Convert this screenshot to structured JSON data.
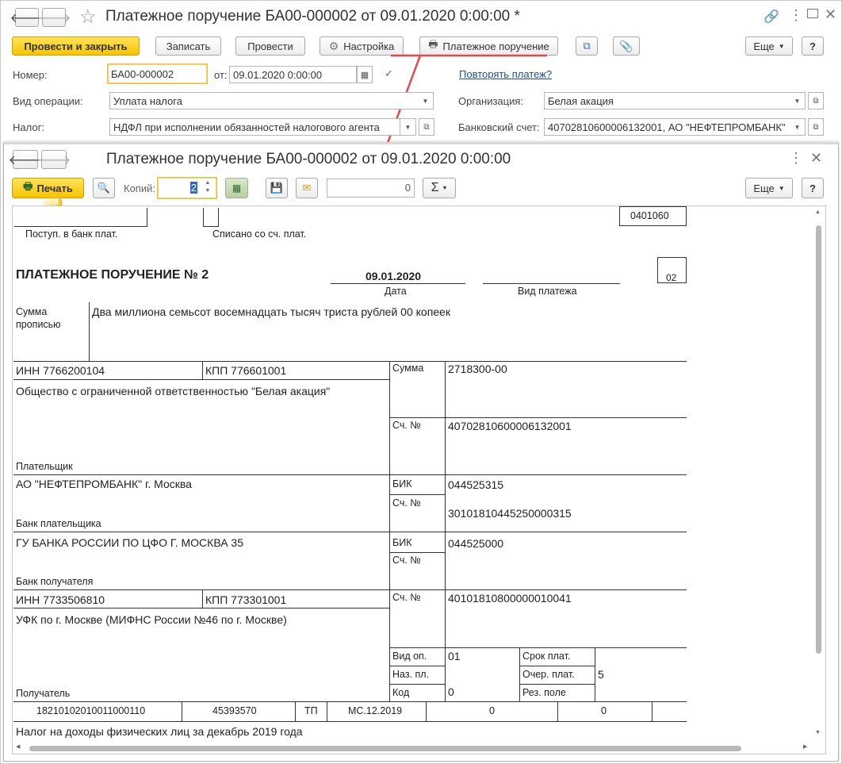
{
  "outer": {
    "title": "Платежное поручение БА00-000002 от 09.01.2020 0:00:00 *",
    "toolbar": {
      "post_close": "Провести и закрыть",
      "save": "Записать",
      "post": "Провести",
      "settings": "Настройка",
      "payment_order": "Платежное поручение",
      "more": "Еще",
      "help": "?"
    },
    "fields": {
      "number_label": "Номер:",
      "number_value": "БА00-000002",
      "date_label": "от:",
      "date_value": "09.01.2020  0:00:00",
      "repeat_link": "Повторять платеж?",
      "operation_label": "Вид операции:",
      "operation_value": "Уплата налога",
      "org_label": "Организация:",
      "org_value": "Белая акация",
      "tax_label": "Налог:",
      "tax_value": "НДФЛ при исполнении обязанностей налогового агента",
      "account_label": "Банковский счет:",
      "account_value": "40702810600006132001, АО \"НЕФТЕПРОМБАНК\""
    }
  },
  "inner": {
    "title": "Платежное поручение БА00-000002 от 09.01.2020 0:00:00",
    "toolbar": {
      "print": "Печать",
      "copies_label": "Копий:",
      "copies_value": "2",
      "sum_value": "0",
      "sigma": "Σ",
      "more": "Еще",
      "help": "?"
    }
  },
  "doc": {
    "form_code": "0401060",
    "received_label": "Поступ. в банк плат.",
    "debited_label": "Списано со сч. плат.",
    "heading": "ПЛАТЕЖНОЕ ПОРУЧЕНИЕ № 2",
    "date": "09.01.2020",
    "date_label": "Дата",
    "payment_type_label": "Вид платежа",
    "status_code": "02",
    "sum_words_label_1": "Сумма",
    "sum_words_label_2": "прописью",
    "sum_words": "Два миллиона семьсот восемнадцать тысяч триста рублей 00 копеек",
    "payer_inn": "ИНН 7766200104",
    "payer_kpp": "КПП 776601001",
    "sum_label": "Сумма",
    "sum_value": "2718300-00",
    "payer_name": "Общество с ограниченной ответственностью \"Белая акация\"",
    "acc_label": "Сч. №",
    "payer_account": "40702810600006132001",
    "payer_label": "Плательщик",
    "payer_bank": "АО \"НЕФТЕПРОМБАНК\" г. Москва",
    "bik_label": "БИК",
    "payer_bik": "044525315",
    "payer_corr_acc": "30101810445250000315",
    "payer_bank_label": "Банк плательщика",
    "recipient_bank": "ГУ БАНКА РОССИИ ПО ЦФО Г. МОСКВА 35",
    "recipient_bik": "044525000",
    "recipient_bank_label": "Банк получателя",
    "recipient_inn": "ИНН 7733506810",
    "recipient_kpp": "КПП 773301001",
    "recipient_account": "40101810800000010041",
    "recipient_name": "УФК по г. Москве (МИФНС России №46 по г. Москве)",
    "op_type_label": "Вид оп.",
    "op_type_value": "01",
    "due_label": "Срок плат.",
    "purpose_code_label": "Наз. пл.",
    "queue_label": "Очер. плат.",
    "queue_value": "5",
    "code_label": "Код",
    "code_value": "0",
    "reserve_label": "Рез. поле",
    "recipient_label": "Получатель",
    "kbk": "18210102010011000110",
    "oktmo": "45393570",
    "basis": "ТП",
    "period": "МС.12.2019",
    "doc_num": "0",
    "doc_date": "0",
    "purpose": "Налог на доходы физических лиц за декабрь 2019 года"
  }
}
